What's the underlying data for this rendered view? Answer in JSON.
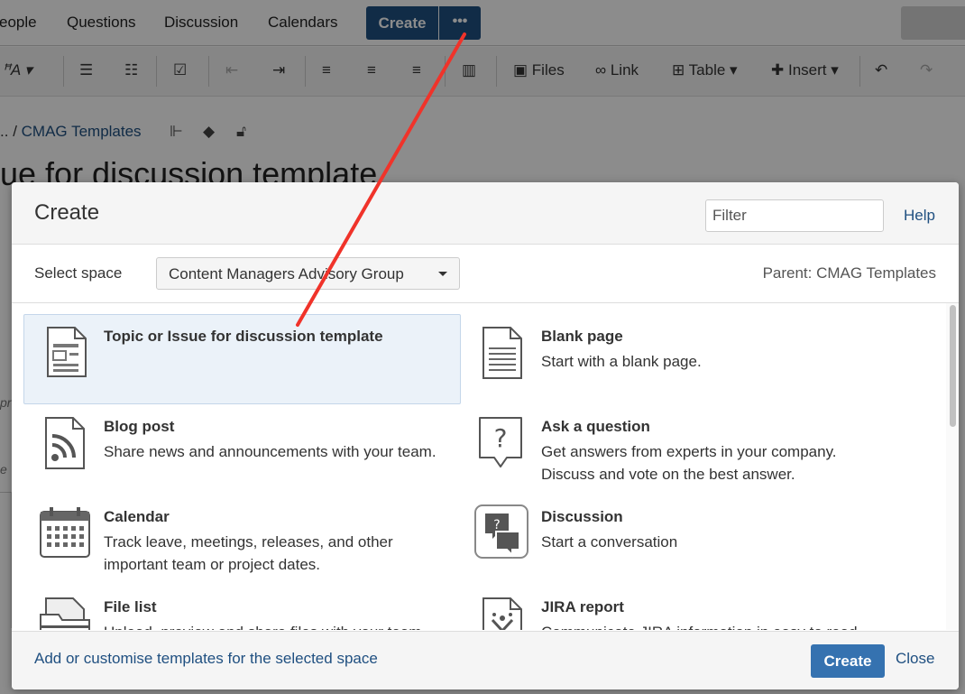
{
  "nav": {
    "people": "eople",
    "questions": "Questions",
    "discussion": "Discussion",
    "calendars": "Calendars",
    "create": "Create",
    "more": "•••"
  },
  "toolbar": {
    "font": "A",
    "files": "Files",
    "link": "Link",
    "table": "Table",
    "insert": "Insert"
  },
  "breadcrumb": {
    "ellipsis": "..",
    "sep": "/",
    "current": "CMAG Templates"
  },
  "page_title": "ue for discussion template",
  "bg_fragments": {
    "a": "pre",
    "b": "e"
  },
  "dialog": {
    "title": "Create",
    "filter_placeholder": "Filter",
    "help": "Help",
    "select_space_label": "Select space",
    "selected_space": "Content Managers Advisory Group",
    "parent": "Parent: CMAG Templates",
    "items": [
      {
        "name": "Topic or Issue for discussion template",
        "desc": "",
        "icon": "template-doc-icon"
      },
      {
        "name": "Blank page",
        "desc": "Start with a blank page.",
        "icon": "blank-page-icon"
      },
      {
        "name": "Blog post",
        "desc": "Share news and announcements with your team.",
        "icon": "blog-post-icon"
      },
      {
        "name": "Ask a question",
        "desc": "Get answers from experts in your company. Discuss and vote on the best answer.",
        "icon": "question-bubble-icon"
      },
      {
        "name": "Calendar",
        "desc": "Track leave, meetings, releases, and other important team or project dates.",
        "icon": "calendar-icon"
      },
      {
        "name": "Discussion",
        "desc": "Start a conversation",
        "icon": "discussion-icon"
      },
      {
        "name": "File list",
        "desc": "Upload, preview and share files with your team.",
        "icon": "file-list-icon"
      },
      {
        "name": "JIRA report",
        "desc": "Communicate JIRA information in easy to read",
        "icon": "jira-report-icon"
      }
    ],
    "footer_link": "Add or customise templates for the selected space",
    "create_button": "Create",
    "close_button": "Close"
  },
  "colors": {
    "brand": "#205081",
    "button": "#3572b0",
    "selected": "#ebf2f9",
    "annotation": "#f0332a"
  }
}
